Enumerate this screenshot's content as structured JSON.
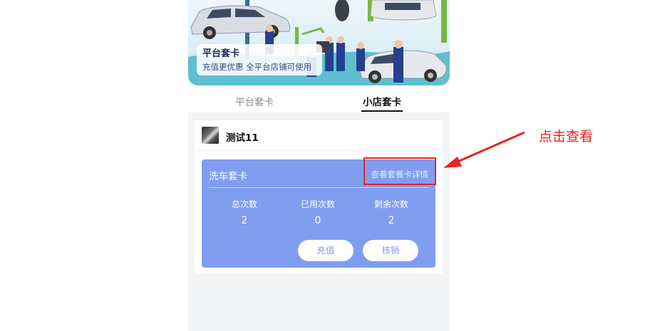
{
  "banner": {
    "title": "平台套卡",
    "subtitle": "充值更优惠   全平台店铺可使用"
  },
  "tabs": [
    {
      "label": "平台套卡",
      "active": false
    },
    {
      "label": "小店套卡",
      "active": true
    }
  ],
  "shop": {
    "name": "测试11"
  },
  "package": {
    "title": "洗车套卡",
    "detail_link": "查看套餐卡详情",
    "stats": [
      {
        "label": "总次数",
        "value": "2"
      },
      {
        "label": "已用次数",
        "value": "0"
      },
      {
        "label": "剩余次数",
        "value": "2"
      }
    ],
    "buttons": {
      "recharge": "充值",
      "verify": "核销"
    },
    "card_color": "#7f9ef0"
  },
  "annotation": {
    "text": "点击查看",
    "color": "#e8231e"
  }
}
